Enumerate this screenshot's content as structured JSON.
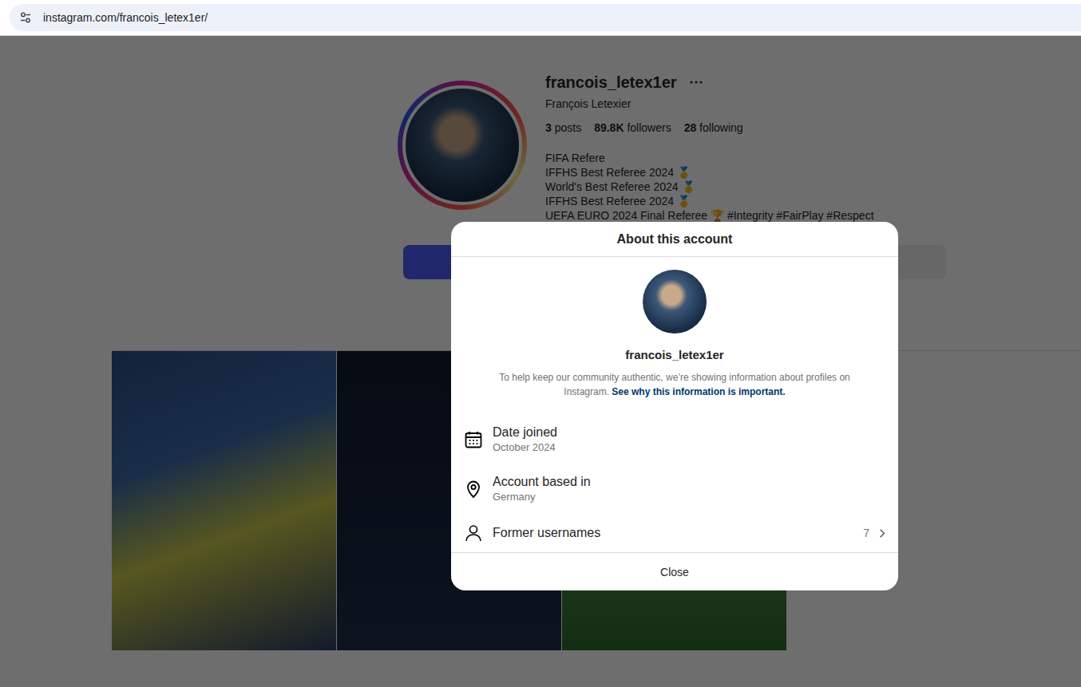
{
  "browser": {
    "url": "instagram.com/francois_letex1er/"
  },
  "profile": {
    "username": "francois_letex1er",
    "full_name": "François Letexier",
    "stats": [
      {
        "count": "3",
        "label": "posts"
      },
      {
        "count": "89.8K",
        "label": "followers"
      },
      {
        "count": "28",
        "label": "following"
      }
    ],
    "bio": [
      "FIFA Refere",
      "IFFHS Best Referee 2024 🥇",
      "World's Best Referee 2024 🥇",
      "IFFHS Best Referee 2024 🥇",
      "UEFA EURO 2024 Final Referee 🏆 #Integrity #FairPlay #Respect"
    ]
  },
  "modal": {
    "title": "About this account",
    "username": "francois_letex1er",
    "description": "To help keep our community authentic, we’re showing information about profiles on Instagram.",
    "link": "See why this information is important.",
    "rows": [
      {
        "kind": "date",
        "label": "Date joined",
        "value": "October 2024"
      },
      {
        "kind": "place",
        "label": "Account based in",
        "value": "Germany"
      },
      {
        "kind": "link",
        "label": "Former usernames",
        "count": "7"
      }
    ],
    "close": "Close"
  }
}
